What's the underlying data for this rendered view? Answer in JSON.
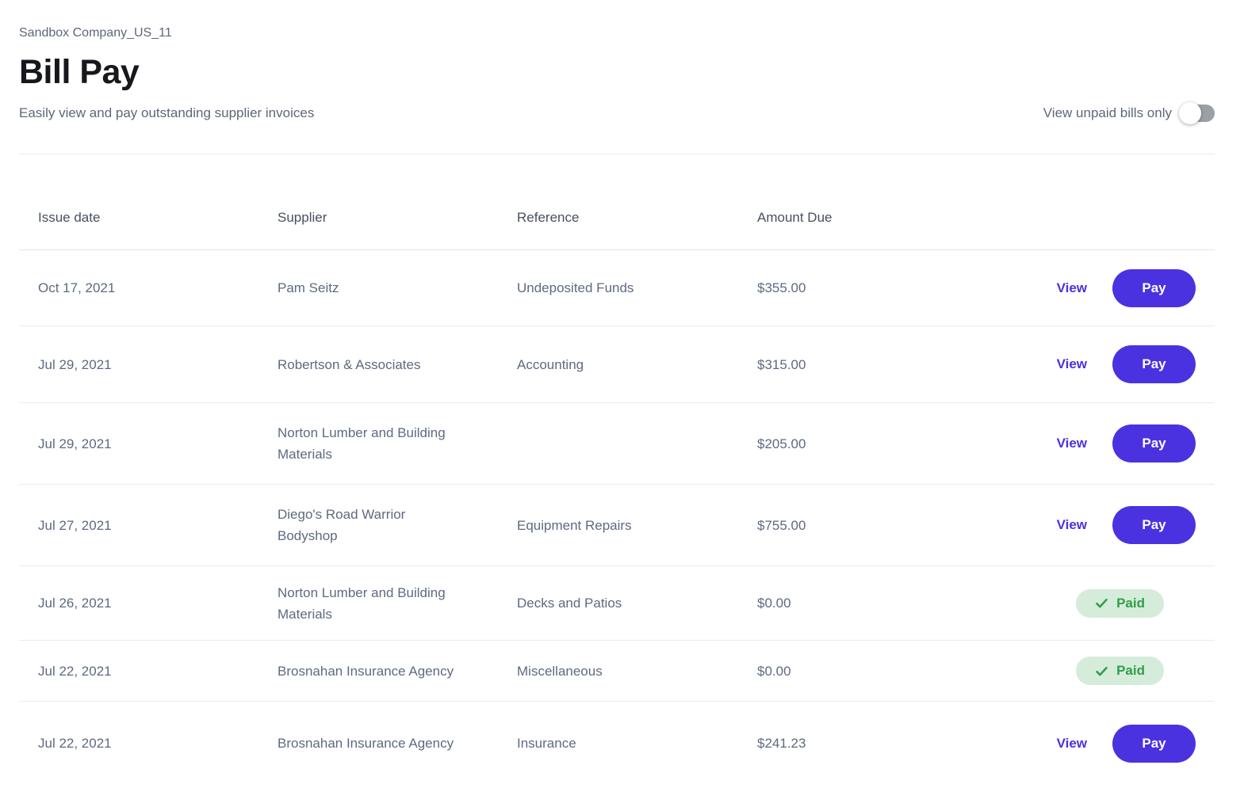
{
  "header": {
    "company": "Sandbox Company_US_11",
    "title": "Bill Pay",
    "subtitle": "Easily view and pay outstanding supplier invoices",
    "toggle_label": "View unpaid bills only",
    "toggle_state": "off"
  },
  "colors": {
    "accent_purple": "#4b32e0",
    "paid_green": "#2f9e48",
    "paid_badge_bg": "#d6ecdb",
    "row_text": "#5e6a80",
    "header_text": "#47505f",
    "toggle_track": "#9aa0a6"
  },
  "table": {
    "columns": [
      "Issue date",
      "Supplier",
      "Reference",
      "Amount Due"
    ],
    "actions": {
      "view_label": "View",
      "pay_label": "Pay",
      "paid_label": "Paid"
    },
    "rows": [
      {
        "issue_date": "Oct 17, 2021",
        "supplier": "Pam Seitz",
        "reference": "Undeposited Funds",
        "amount_due": "$355.00",
        "status": "unpaid"
      },
      {
        "issue_date": "Jul 29, 2021",
        "supplier": "Robertson & Associates",
        "reference": "Accounting",
        "amount_due": "$315.00",
        "status": "unpaid"
      },
      {
        "issue_date": "Jul 29, 2021",
        "supplier": "Norton Lumber and Building Materials",
        "reference": "",
        "amount_due": "$205.00",
        "status": "unpaid"
      },
      {
        "issue_date": "Jul 27, 2021",
        "supplier": "Diego's Road Warrior Bodyshop",
        "reference": "Equipment Repairs",
        "amount_due": "$755.00",
        "status": "unpaid"
      },
      {
        "issue_date": "Jul 26, 2021",
        "supplier": "Norton Lumber and Building Materials",
        "reference": "Decks and Patios",
        "amount_due": "$0.00",
        "status": "paid"
      },
      {
        "issue_date": "Jul 22, 2021",
        "supplier": "Brosnahan Insurance Agency",
        "reference": "Miscellaneous",
        "amount_due": "$0.00",
        "status": "paid"
      },
      {
        "issue_date": "Jul 22, 2021",
        "supplier": "Brosnahan Insurance Agency",
        "reference": "Insurance",
        "amount_due": "$241.23",
        "status": "unpaid"
      }
    ]
  }
}
